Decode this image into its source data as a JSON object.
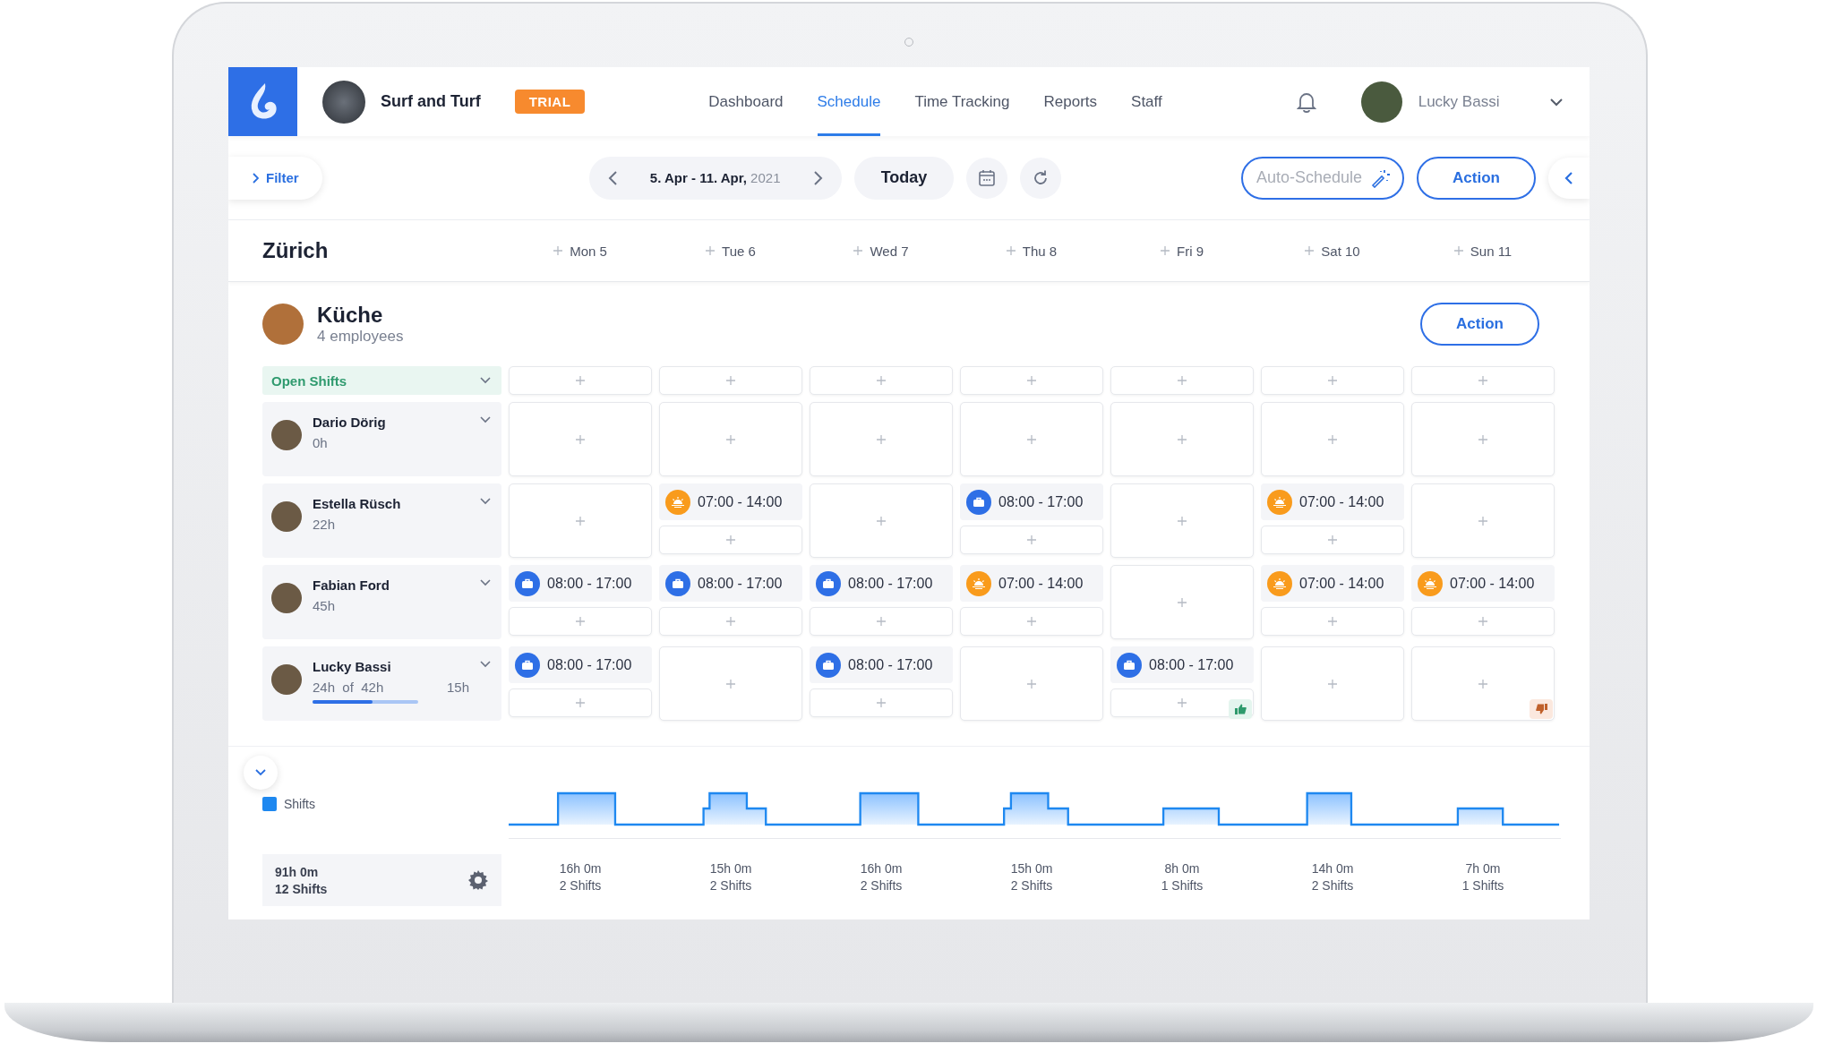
{
  "brand": {
    "name": "Surf and Turf",
    "badge": "TRIAL"
  },
  "nav": [
    {
      "label": "Dashboard",
      "selected": false
    },
    {
      "label": "Schedule",
      "selected": true
    },
    {
      "label": "Time Tracking",
      "selected": false
    },
    {
      "label": "Reports",
      "selected": false
    },
    {
      "label": "Staff",
      "selected": false
    }
  ],
  "user": {
    "name": "Lucky Bassi"
  },
  "toolbar": {
    "filter": "Filter",
    "range": "5. Apr - 11. Apr,",
    "year": "2021",
    "today": "Today",
    "auto_schedule": "Auto-Schedule",
    "action": "Action"
  },
  "location": "Zürich",
  "days": [
    "Mon 5",
    "Tue 6",
    "Wed 7",
    "Thu 8",
    "Fri 9",
    "Sat 10",
    "Sun 11"
  ],
  "team": {
    "name": "Küche",
    "subtitle": "4 employees",
    "action": "Action",
    "open_shifts": "Open Shifts"
  },
  "employees": [
    {
      "name": "Dario Dörig",
      "hours": "0h",
      "cells": [
        {
          "kind": "plain"
        },
        {
          "kind": "plain"
        },
        {
          "kind": "plain"
        },
        {
          "kind": "plain"
        },
        {
          "kind": "plain"
        },
        {
          "kind": "plain"
        },
        {
          "kind": "plain"
        }
      ]
    },
    {
      "name": "Estella Rüsch",
      "hours": "22h",
      "cells": [
        {
          "kind": "plain"
        },
        {
          "kind": "plain",
          "shifts": [
            {
              "kind": "morning",
              "time": "07:00 - 14:00"
            }
          ]
        },
        {
          "kind": "plain"
        },
        {
          "kind": "plain",
          "shifts": [
            {
              "kind": "work",
              "time": "08:00 - 17:00"
            }
          ]
        },
        {
          "kind": "plain"
        },
        {
          "kind": "plain",
          "shifts": [
            {
              "kind": "morning",
              "time": "07:00 - 14:00"
            }
          ]
        },
        {
          "kind": "plain"
        }
      ]
    },
    {
      "name": "Fabian Ford",
      "hours": "45h",
      "cells": [
        {
          "kind": "plain",
          "shifts": [
            {
              "kind": "work",
              "time": "08:00 - 17:00"
            }
          ]
        },
        {
          "kind": "plain",
          "shifts": [
            {
              "kind": "work",
              "time": "08:00 - 17:00"
            }
          ]
        },
        {
          "kind": "plain",
          "shifts": [
            {
              "kind": "work",
              "time": "08:00 - 17:00"
            }
          ]
        },
        {
          "kind": "plain",
          "shifts": [
            {
              "kind": "morning",
              "time": "07:00 - 14:00"
            }
          ]
        },
        {
          "kind": "plain"
        },
        {
          "kind": "plain",
          "shifts": [
            {
              "kind": "morning",
              "time": "07:00 - 14:00"
            }
          ]
        },
        {
          "kind": "plain",
          "shifts": [
            {
              "kind": "morning",
              "time": "07:00 - 14:00"
            }
          ]
        }
      ]
    },
    {
      "name": "Lucky Bassi",
      "hours": "24h  of  42h",
      "remaining": "15h",
      "level": 0.57,
      "cells": [
        {
          "kind": "plain",
          "shifts": [
            {
              "kind": "work",
              "time": "08:00 - 17:00"
            }
          ]
        },
        {
          "kind": "plain"
        },
        {
          "kind": "plain",
          "shifts": [
            {
              "kind": "work",
              "time": "08:00 - 17:00"
            }
          ]
        },
        {
          "kind": "plain"
        },
        {
          "kind": "approved",
          "shifts": [
            {
              "kind": "work",
              "time": "08:00 - 17:00"
            }
          ]
        },
        {
          "kind": "plain"
        },
        {
          "kind": "rejected"
        }
      ]
    }
  ],
  "summary": {
    "legend": "Shifts",
    "total_hours": "91h 0m",
    "total_shifts": "12 Shifts",
    "days": [
      {
        "hours": "16h 0m",
        "shifts": "2 Shifts"
      },
      {
        "hours": "15h 0m",
        "shifts": "2 Shifts"
      },
      {
        "hours": "16h 0m",
        "shifts": "2 Shifts"
      },
      {
        "hours": "15h 0m",
        "shifts": "2 Shifts"
      },
      {
        "hours": "8h 0m",
        "shifts": "1 Shifts"
      },
      {
        "hours": "14h 0m",
        "shifts": "2 Shifts"
      },
      {
        "hours": "7h 0m",
        "shifts": "1 Shifts"
      }
    ]
  }
}
